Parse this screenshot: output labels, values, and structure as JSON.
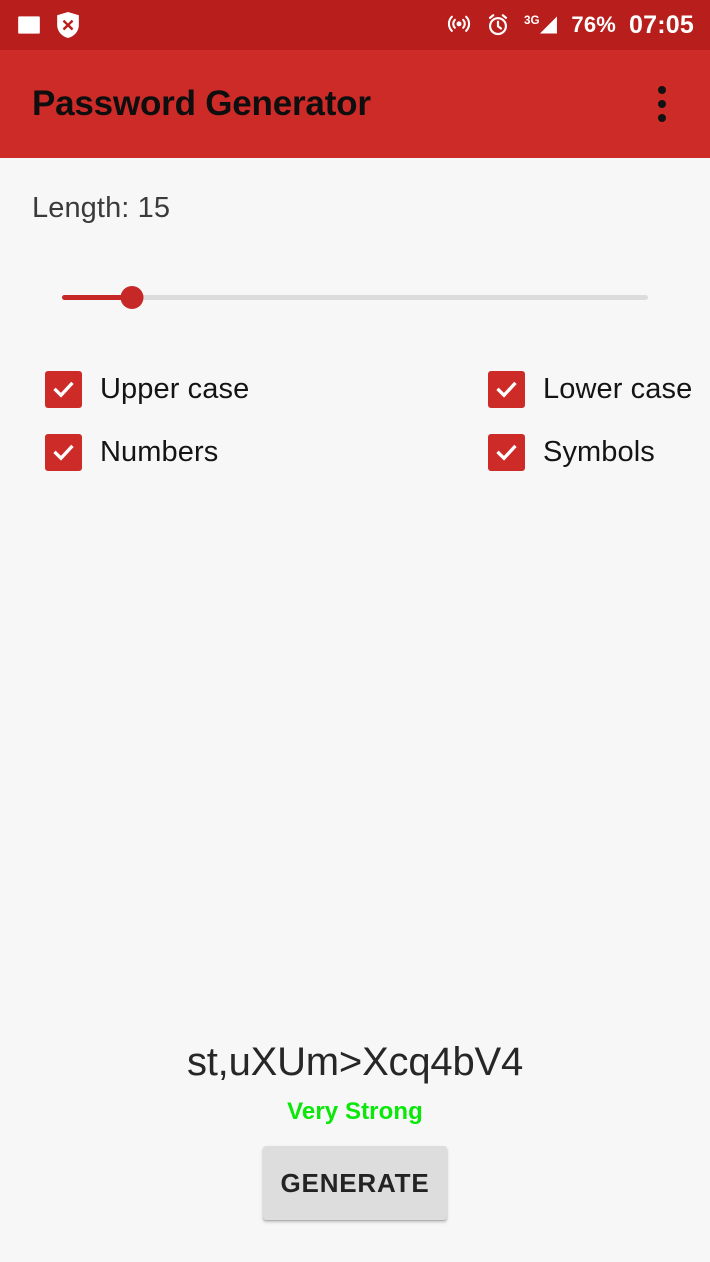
{
  "status_bar": {
    "background_color": "#B81F1C",
    "left_icons": [
      {
        "name": "photo-icon"
      },
      {
        "name": "shield-x-icon"
      }
    ],
    "right_icons": [
      {
        "name": "hotspot-icon"
      },
      {
        "name": "alarm-clock-icon"
      },
      {
        "name": "signal-3g-icon",
        "label": "3G"
      }
    ],
    "battery": "76%",
    "clock": "07:05"
  },
  "app_bar": {
    "title": "Password Generator",
    "background_color": "#CC2B28",
    "overflow_icon": "more-vert-icon"
  },
  "main": {
    "length": {
      "label": "Length: 15",
      "value": 15,
      "percent": 12
    },
    "options": [
      [
        {
          "label": "Upper case",
          "checked": true,
          "key": "upper-case"
        },
        {
          "label": "Lower case",
          "checked": true,
          "key": "lower-case"
        }
      ],
      [
        {
          "label": "Numbers",
          "checked": true,
          "key": "numbers"
        },
        {
          "label": "Symbols",
          "checked": true,
          "key": "symbols"
        }
      ]
    ],
    "result": {
      "password": "st,uXUm>Xcq4bV4",
      "strength": "Very Strong",
      "strength_color": "#09E809",
      "generate_label": "GENERATE"
    }
  },
  "colors": {
    "accent": "#CC2B28",
    "accent_dark": "#B81F1C",
    "page_background": "#F7F7F7"
  }
}
